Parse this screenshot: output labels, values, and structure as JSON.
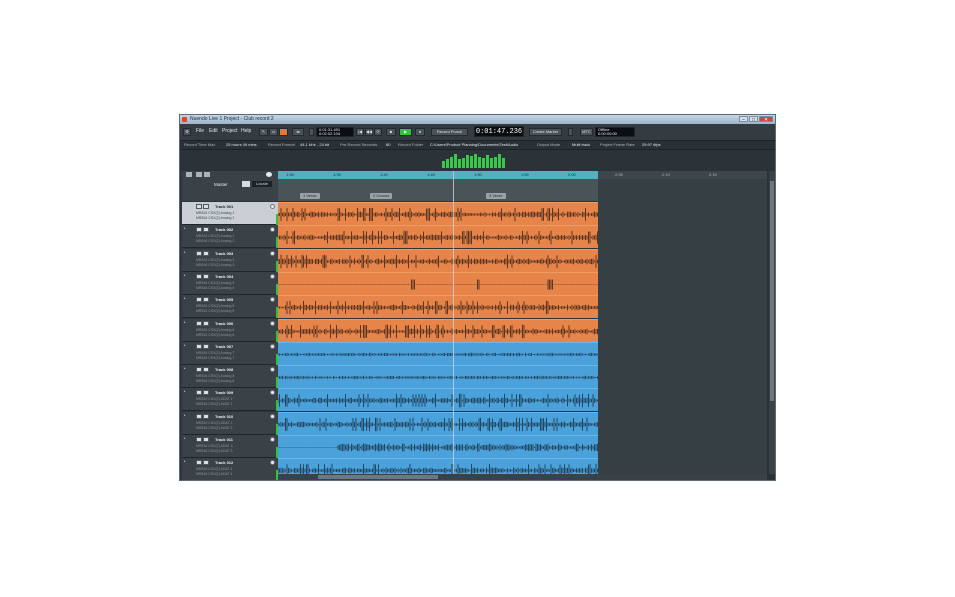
{
  "window": {
    "title": "Nuendo Live 1 Project - Club record 2",
    "buttons": {
      "minimize": "–",
      "maximize": "□",
      "close": "✕"
    }
  },
  "menu": [
    "File",
    "Edit",
    "Project",
    "Help"
  ],
  "transport": {
    "position_top": "0:01:31.491",
    "position_bottom": "0:02:02.104",
    "record_punch_label": "Record Punch",
    "main_time": "0:01:47.236",
    "create_marker_label": "Create Marker",
    "mtc_label": "MTC",
    "status_top": "Offline",
    "status_bottom": "0:00:00:00"
  },
  "info": {
    "record_time_max_label": "Record Time Max",
    "record_time_max": "25 hours 49 mins",
    "record_format_label": "Record Format",
    "record_format": "44.1 kHz - 24 bit",
    "pre_record_label": "Pre-Record Seconds",
    "pre_record": "60",
    "record_folder_label": "Record Folder",
    "record_folder": "C:\\Users\\Product Planning\\Documents\\Test\\Audio",
    "output_mode_label": "Output Mode",
    "output_mode": "Multi track",
    "frame_rate_label": "Project Frame Rate",
    "frame_rate": "29.97 dfps"
  },
  "meter_levels": [
    0.45,
    0.55,
    0.7,
    0.85,
    0.55,
    0.6,
    0.8,
    0.75,
    0.9,
    0.7,
    0.65,
    0.8,
    0.6,
    0.7,
    0.85,
    0.6
  ],
  "ruler": {
    "ticks": [
      "1:30",
      "1:35",
      "1:40",
      "1:45",
      "1:50",
      "1:55",
      "2:00",
      "2:05",
      "2:10",
      "2:15"
    ]
  },
  "markers": [
    "1 Verse",
    "2 Chorus",
    "3 Verse"
  ],
  "master": {
    "label": "Master",
    "dropdown": "Locate"
  },
  "tracks": [
    {
      "name": "Track 001",
      "in": "MR816 CSX(2) Analog 1",
      "out": "MR816 CSX(2) Analog 1",
      "color": "orange",
      "selected": true
    },
    {
      "name": "Track 002",
      "in": "MR816 CSX(2) Analog 2",
      "out": "MR816 CSX(2) Analog 2",
      "color": "orange",
      "selected": false
    },
    {
      "name": "Track 003",
      "in": "MR816 CSX(2) Analog 3",
      "out": "MR816 CSX(2) Analog 3",
      "color": "orange",
      "selected": false
    },
    {
      "name": "Track 004",
      "in": "MR816 CSX(2) Analog 4",
      "out": "MR816 CSX(2) Analog 4",
      "color": "orange",
      "selected": false
    },
    {
      "name": "Track 005",
      "in": "MR816 CSX(2) Analog 5",
      "out": "MR816 CSX(2) Analog 5",
      "color": "orange",
      "selected": false
    },
    {
      "name": "Track 006",
      "in": "MR816 CSX(2) Analog 6",
      "out": "MR816 CSX(2) Analog 6",
      "color": "orange",
      "selected": false
    },
    {
      "name": "Track 007",
      "in": "MR816 CSX(2) Analog 7",
      "out": "MR816 CSX(2) Analog 7",
      "color": "blue",
      "selected": false
    },
    {
      "name": "Track 008",
      "in": "MR816 CSX(2) Analog 8",
      "out": "MR816 CSX(2) Analog 8",
      "color": "blue",
      "selected": false
    },
    {
      "name": "Track 009",
      "in": "MR816 CSX(2) ADAT 1",
      "out": "MR816 CSX(2) ADAT 1",
      "color": "blue",
      "selected": false
    },
    {
      "name": "Track 010",
      "in": "MR816 CSX(2) ADAT 2",
      "out": "MR816 CSX(2) ADAT 2",
      "color": "blue",
      "selected": false
    },
    {
      "name": "Track 011",
      "in": "MR816 CSX(2) ADAT 3",
      "out": "MR816 CSX(2) ADAT 3",
      "color": "blue",
      "selected": false
    },
    {
      "name": "Track 012",
      "in": "MR816 CSX(2) ADAT 4",
      "out": "MR816 CSX(2) ADAT 4",
      "color": "blue",
      "selected": false
    }
  ]
}
